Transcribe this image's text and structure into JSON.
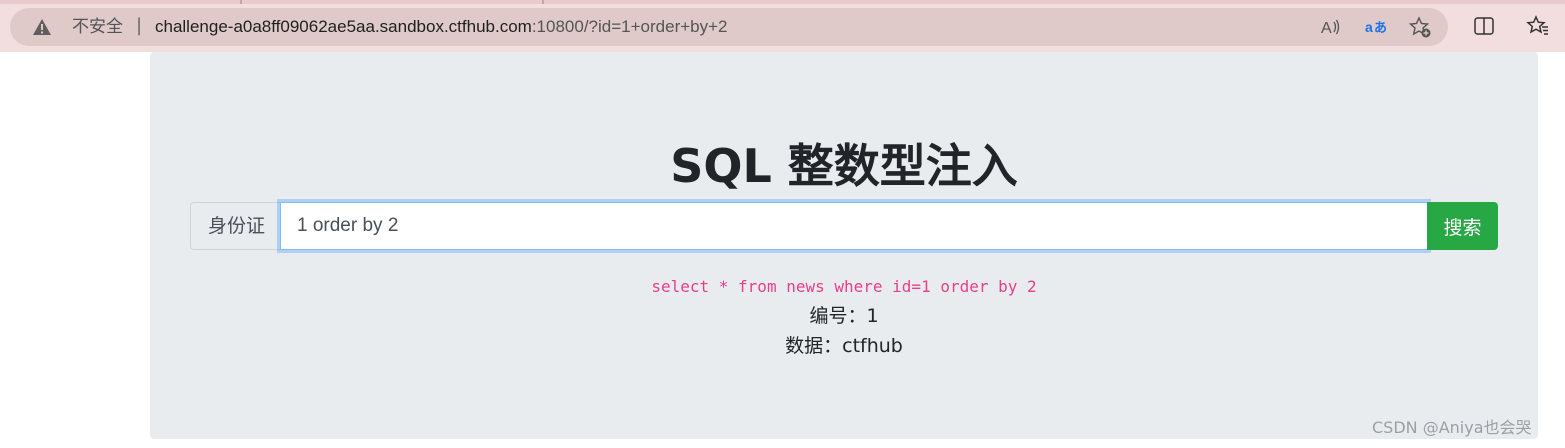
{
  "browser": {
    "security_label": "不安全",
    "separator": "|",
    "url_host": "challenge-a0a8ff09062ae5aa.sandbox.ctfhub.com",
    "url_rest": ":10800/?id=1+order+by+2",
    "icons": {
      "security": "warning-triangle-icon",
      "read_aloud": "read-aloud-icon",
      "translate": "translate-icon",
      "favorite": "add-favorite-icon",
      "split_screen": "split-screen-icon",
      "favorites_bar": "favorites-icon"
    }
  },
  "page": {
    "title": "SQL 整数型注入",
    "form": {
      "prefix_label": "身份证",
      "input_value": "1 order by 2",
      "search_button_label": "搜索"
    },
    "sql_query": "select * from news where id=1 order by 2",
    "result": {
      "id_line": "编号：1",
      "data_line": "数据：ctfhub"
    }
  },
  "watermark": "CSDN @Aniya也会哭",
  "colors": {
    "chrome_bg": "#f2dede",
    "addressbar_bg": "#dfc9c9",
    "panel_bg": "#e9ecef",
    "sql_text": "#e83e8c",
    "search_button": "#28a745",
    "input_focus": "#80bdff"
  }
}
